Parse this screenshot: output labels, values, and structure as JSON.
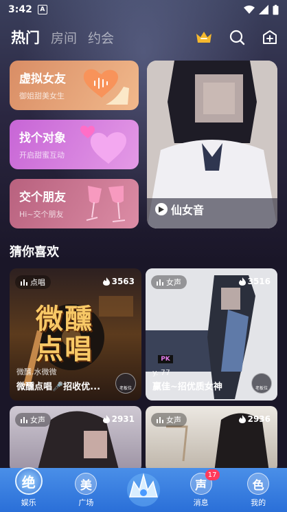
{
  "status_bar": {
    "time": "3:42",
    "notif_glyph": "A"
  },
  "header": {
    "tabs": [
      {
        "label": "热门",
        "active": true
      },
      {
        "label": "房间",
        "active": false
      },
      {
        "label": "约会",
        "active": false
      }
    ],
    "icons": [
      "crown-icon",
      "search-icon",
      "add-icon"
    ]
  },
  "categories": [
    {
      "title": "虚拟女友",
      "subtitle": "御姐甜美女生"
    },
    {
      "title": "找个对象",
      "subtitle": "开启甜蜜互动"
    },
    {
      "title": "交个朋友",
      "subtitle": "Hi~交个朋友"
    }
  ],
  "feature": {
    "label": "仙女音"
  },
  "section": {
    "title": "猜你喜欢"
  },
  "rooms": [
    {
      "tag": "点唱",
      "heat": "3563",
      "host": "微醺.水微微",
      "title": "微醺点唱🎤招收优...",
      "poster_text": "微醺点唱",
      "badge": "老板位"
    },
    {
      "tag": "女声",
      "heat": "3516",
      "host": "y.  77",
      "title": "赢佳~招优质女神",
      "poster_text": "",
      "badge": "老板位"
    },
    {
      "tag": "女声",
      "heat": "2931",
      "host": "",
      "title": "",
      "poster_text": "",
      "badge": ""
    },
    {
      "tag": "女声",
      "heat": "2936",
      "host": "",
      "title": "",
      "poster_text": "",
      "badge": ""
    }
  ],
  "bottom_nav": [
    {
      "glyph": "绝",
      "label": "娱乐",
      "active": true
    },
    {
      "glyph": "美",
      "label": "广场",
      "active": false
    },
    {
      "glyph": "",
      "label": "",
      "active": false
    },
    {
      "glyph": "声",
      "label": "消息",
      "active": false,
      "badge": "17"
    },
    {
      "glyph": "色",
      "label": "我的",
      "active": false
    }
  ],
  "colors": {
    "accent_orange": "#e89a6a",
    "accent_pink": "#d27ce0",
    "accent_rose": "#c86a8e",
    "nav_blue": "#3a7fe0",
    "badge_red": "#ff3b5c"
  }
}
